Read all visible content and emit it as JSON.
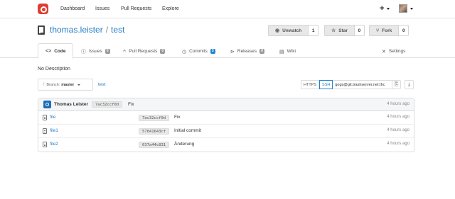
{
  "navbar": {
    "links": [
      "Dashboard",
      "Issues",
      "Pull Requests",
      "Explore"
    ],
    "plus_label": "+"
  },
  "repo": {
    "owner": "thomas.leister",
    "separator": "/",
    "name": "test",
    "watch": {
      "label": "Unwatch",
      "count": "1"
    },
    "star": {
      "label": "Star",
      "count": "0"
    },
    "fork": {
      "label": "Fork",
      "count": "0"
    }
  },
  "tabs": [
    {
      "label": "Code",
      "icon": "code-icon"
    },
    {
      "label": "Issues",
      "badge": "0",
      "icon": "issue-icon"
    },
    {
      "label": "Pull Requests",
      "badge": "0",
      "icon": "pull-request-icon"
    },
    {
      "label": "Commits",
      "badge": "3",
      "icon": "history-icon"
    },
    {
      "label": "Releases",
      "badge": "0",
      "icon": "tag-icon"
    },
    {
      "label": "Wiki",
      "icon": "book-icon"
    },
    {
      "label": "Settings",
      "icon": "tools-icon"
    }
  ],
  "description": "No Description",
  "branch": {
    "prefix": "Branch:",
    "name": "master"
  },
  "breadcrumb_repo": "test",
  "clone": {
    "https_label": "HTTPS",
    "ssh_label": "SSH",
    "url": "gogs@git.trashserver.net:thc"
  },
  "latest_commit": {
    "author": "Thomas Leister",
    "sha": "7ac32ccf0d",
    "message": "Fix",
    "time": "4 hours ago"
  },
  "files": [
    {
      "name": "file",
      "sha": "7ac32ccf0d",
      "message": "Fix",
      "time": "4 hours ago"
    },
    {
      "name": "file1",
      "sha": "57041643cf",
      "message": "Initial commit",
      "time": "4 hours ago"
    },
    {
      "name": "file2",
      "sha": "037a44c831",
      "message": "Änderung",
      "time": "4 hours ago"
    }
  ],
  "colors": {
    "link": "#2a7ec5",
    "logo": "#e03c31",
    "accent": "#2185d0"
  }
}
